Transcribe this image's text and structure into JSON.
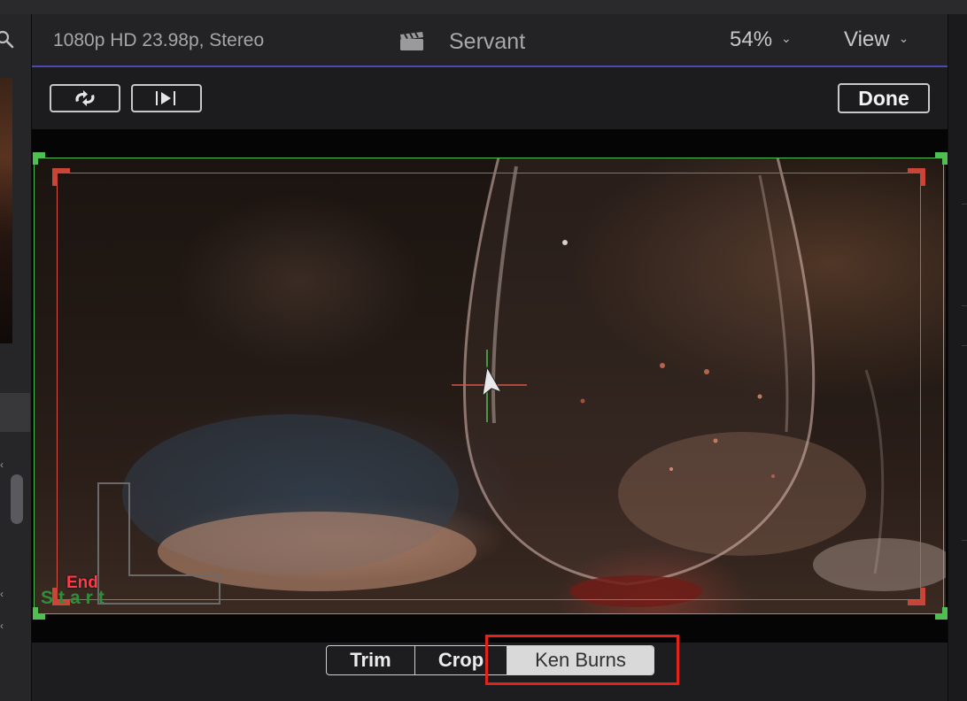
{
  "viewer": {
    "format": "1080p HD 23.98p, Stereo",
    "project_title": "Servant",
    "zoom": "54%",
    "view_label": "View"
  },
  "toolbar": {
    "done_label": "Done"
  },
  "overlay": {
    "end_label": "End",
    "start_label": "Start",
    "start_color": "#4fbf52",
    "end_color": "#d8544a"
  },
  "mode_selector": {
    "options": [
      "Trim",
      "Crop",
      "Ken Burns"
    ],
    "selected": "Ken Burns"
  },
  "highlight_color": "#e3221c"
}
